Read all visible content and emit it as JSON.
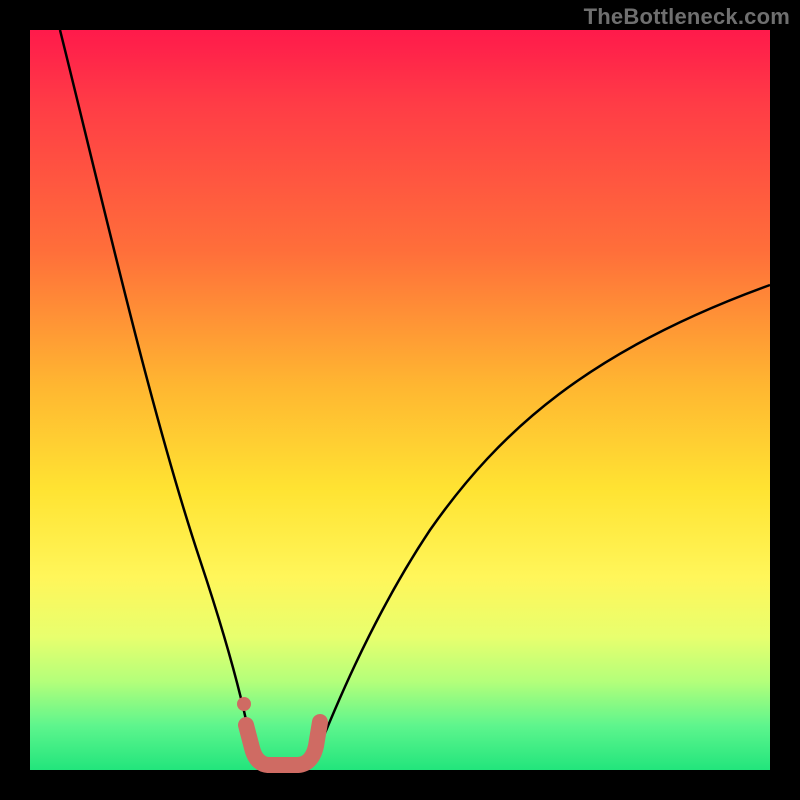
{
  "watermark": {
    "text": "TheBottleneck.com"
  },
  "chart_data": {
    "type": "line",
    "title": "",
    "xlabel": "",
    "ylabel": "",
    "xlim": [
      0,
      100
    ],
    "ylim": [
      0,
      100
    ],
    "series": [
      {
        "name": "left-curve",
        "x": [
          4,
          6,
          8,
          10,
          12,
          14,
          16,
          18,
          20,
          22,
          24,
          26,
          28,
          29,
          30
        ],
        "values": [
          100,
          90,
          80,
          70,
          60,
          51,
          42,
          34,
          27,
          20,
          14,
          9,
          5,
          3,
          1
        ]
      },
      {
        "name": "right-curve",
        "x": [
          38,
          40,
          44,
          48,
          52,
          56,
          60,
          64,
          68,
          72,
          76,
          80,
          84,
          88,
          92,
          96,
          100
        ],
        "values": [
          1,
          3,
          8,
          14,
          20,
          26,
          32,
          37,
          42,
          46,
          50,
          53,
          56,
          59,
          62,
          64,
          66
        ]
      },
      {
        "name": "highlight-segment",
        "style": "thick-salmon",
        "x": [
          29,
          30,
          31,
          33,
          35,
          37,
          38,
          39
        ],
        "values": [
          6,
          4,
          1,
          0,
          0,
          1,
          4,
          7
        ]
      },
      {
        "name": "highlight-dot",
        "style": "dot-salmon",
        "x": [
          29
        ],
        "values": [
          9
        ]
      }
    ],
    "colors": {
      "curve": "#000000",
      "highlight": "#cf6b63"
    }
  }
}
